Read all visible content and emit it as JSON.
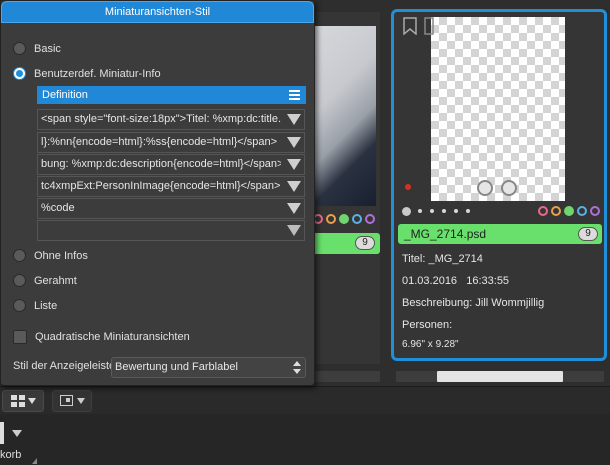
{
  "dialog": {
    "title": "Miniaturansichten-Stil",
    "options": {
      "basic": "Basic",
      "custom": "Benutzerdef. Miniatur-Info",
      "none": "Ohne Infos",
      "framed": "Gerahmt",
      "list": "Liste"
    },
    "selected_option": "custom",
    "definition_header": "Definition",
    "definition_rows": [
      "<span style=\"font-size:18px\">Titel: %xmp:dc:title..",
      "l}:%nn{encode=html}:%ss{encode=html}</span>",
      "bung: %xmp:dc:description{encode=html}</span>",
      "tc4xmpExt:PersonInImage{encode=html}</span>",
      "%code",
      ""
    ],
    "square_thumbs_label": "Quadratische Miniaturansichten",
    "square_thumbs_checked": false,
    "display_style_label": "Stil der Anzeigeleiste",
    "display_style_value": "Bewertung und Farblabel"
  },
  "thumbnail_left": {
    "badge": "9"
  },
  "thumbnail_selected": {
    "filename": "_MG_2714.psd",
    "badge": "9",
    "title_line": "Titel: _MG_2714",
    "date": "01.03.2016",
    "time": "16:33:55",
    "description_line": "Beschreibung: Jill Wommjillig",
    "persons_line": "Personen:",
    "dimensions": "6.96\" x 9.28\""
  },
  "color_labels": [
    "#e86a8a",
    "#e8a04a",
    "#6fd66f",
    "#5ab0e8",
    "#b070d8"
  ],
  "accent_color": "#2188d8",
  "label_green": "#69e06c",
  "bottom_panel": {
    "label": "korb"
  }
}
